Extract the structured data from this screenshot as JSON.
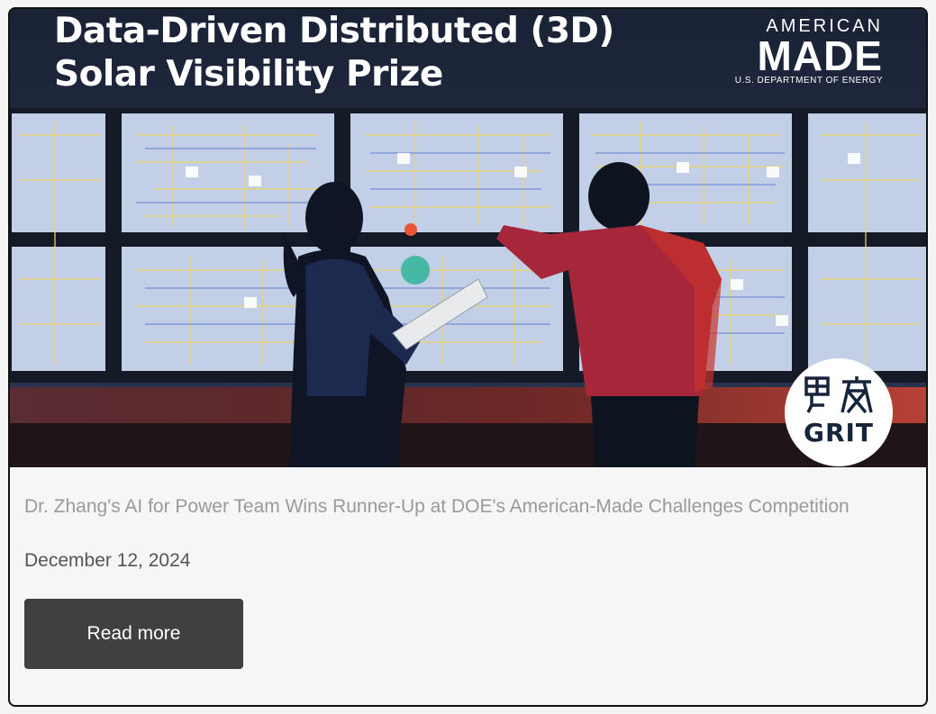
{
  "hero": {
    "title_line1": "Data-Driven Distributed (3D)",
    "title_line2": "Solar Visibility Prize",
    "brand": {
      "top": "AMERICAN",
      "main": "MADE",
      "sub": "U.S. DEPARTMENT OF ENERGY"
    },
    "badge_text": "GRIT",
    "badge_icons": [
      "solar-panel-icon",
      "transmission-tower-icon"
    ],
    "photo_subject": "control-room-photo",
    "colors": {
      "badge_text": "#16243c",
      "panel_bg": "#c7d2e8",
      "wire": "#e8d36a"
    }
  },
  "article": {
    "headline": "Dr. Zhang's AI for Power Team Wins Runner-Up at DOE's American-Made Challenges Competition",
    "date": "December 12, 2024",
    "read_more_label": "Read more"
  },
  "colors": {
    "button_bg": "#404040",
    "headline_text": "#9a9a9a",
    "date_text": "#555555",
    "card_bg": "#f6f6f6"
  }
}
